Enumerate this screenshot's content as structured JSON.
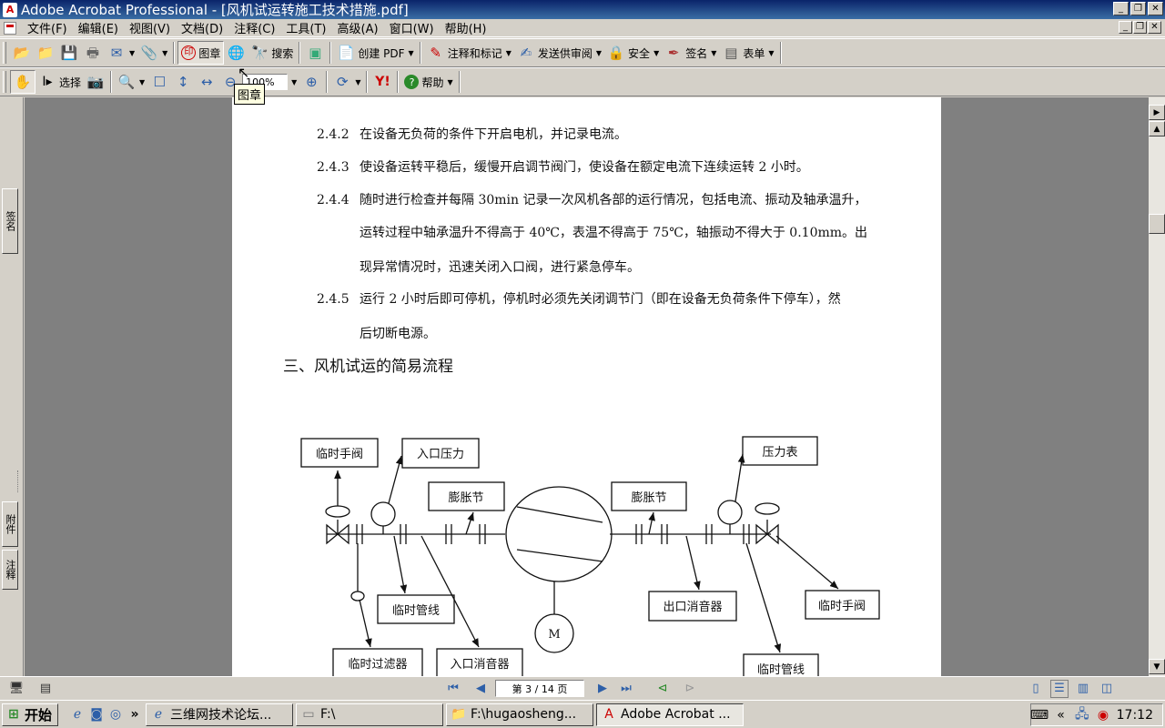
{
  "window": {
    "title": "Adobe Acrobat Professional - [风机试运转施工技术措施.pdf]"
  },
  "menu": [
    "文件(F)",
    "编辑(E)",
    "视图(V)",
    "文档(D)",
    "注释(C)",
    "工具(T)",
    "高级(A)",
    "窗口(W)",
    "帮助(H)"
  ],
  "toolbar1": {
    "stamp": "图章",
    "search": "搜索",
    "create_pdf": "创建 PDF",
    "comment": "注释和标记",
    "send_review": "发送供审阅",
    "security": "安全",
    "sign": "签名",
    "forms": "表单"
  },
  "toolbar2": {
    "select": "选择",
    "zoom": "100%",
    "help": "帮助"
  },
  "tooltip": "图章",
  "side_tabs": {
    "signatures": "签名",
    "attachments": "附件",
    "comments": "注释"
  },
  "document": {
    "paras": [
      {
        "num": "2.4.2",
        "lines": [
          "在设备无负荷的条件下开启电机，并记录电流。"
        ]
      },
      {
        "num": "2.4.3",
        "lines": [
          "使设备运转平稳后，缓慢开启调节阀门，使设备在额定电流下连续运转 2 小时。"
        ]
      },
      {
        "num": "2.4.4",
        "lines": [
          "随时进行检查并每隔 30min 记录一次风机各部的运行情况，包括电流、振动及轴承温升，",
          "运转过程中轴承温升不得高于 40℃，表温不得高于 75℃，轴振动不得大于 0.10mm。出",
          "现异常情况时，迅速关闭入口阀，进行紧急停车。"
        ]
      },
      {
        "num": "2.4.5",
        "lines": [
          "运行 2 小时后即可停机，停机时必须先关闭调节门（即在设备无负荷条件下停车），然",
          "后切断电源。"
        ]
      }
    ],
    "section_title": "三、风机试运的简易流程",
    "diagram": {
      "temp_valve_in": "临时手阀",
      "inlet_pressure": "入口压力",
      "expansion_left": "膨胀节",
      "expansion_right": "膨胀节",
      "pressure_gauge": "压力表",
      "temp_pipe_left": "临时管线",
      "outlet_silencer": "出口消音器",
      "temp_valve_out": "临时手阀",
      "temp_filter": "临时过滤器",
      "inlet_silencer": "入口消音器",
      "temp_pipe_right": "临时管线",
      "motor": "M"
    }
  },
  "statusbar": {
    "page": "第 3 / 14 页"
  },
  "taskbar": {
    "start": "开始",
    "tasks": [
      "三维网技术论坛...",
      "F:\\",
      "F:\\hugaosheng...",
      "Adobe Acrobat ..."
    ],
    "clock": "17:12"
  }
}
